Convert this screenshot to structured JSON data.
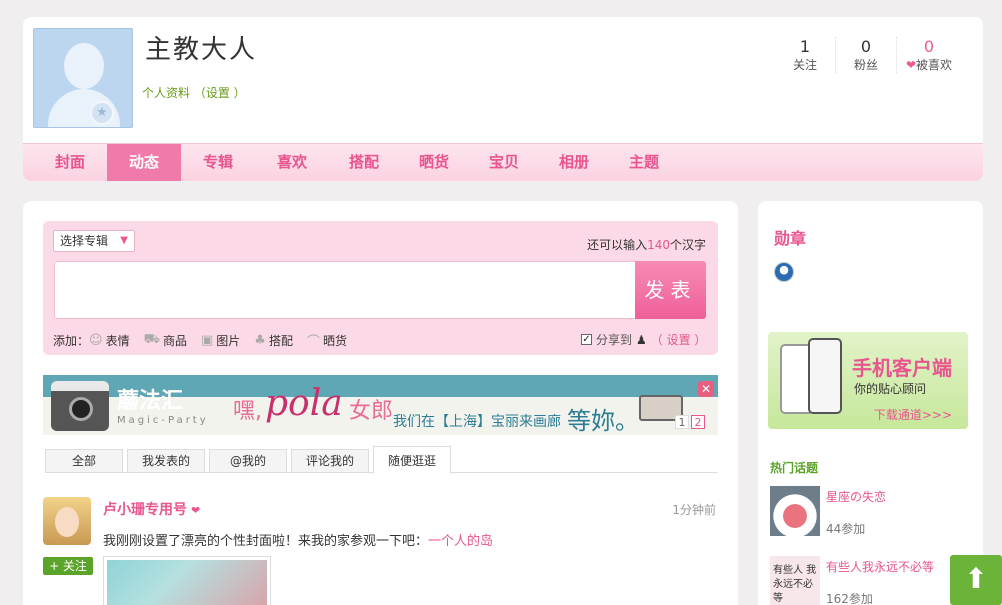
{
  "profile": {
    "name": "主教大人",
    "links_text": "个人资料 （设置 ）",
    "stats": [
      {
        "num": "1",
        "label": "关注"
      },
      {
        "num": "0",
        "label": "粉丝"
      },
      {
        "num": "0",
        "label": "被喜欢"
      }
    ]
  },
  "nav": [
    "封面",
    "动态",
    "专辑",
    "喜欢",
    "搭配",
    "晒货",
    "宝贝",
    "相册",
    "主题"
  ],
  "post_box": {
    "album_select": "选择专辑",
    "char_count_prefix": "还可以输入",
    "char_count": "140",
    "char_count_suffix": "个汉字",
    "publish": "发表",
    "add_label": "添加：",
    "tools": [
      "表情",
      "商品",
      "图片",
      "搭配",
      "晒货"
    ],
    "share_label": "分享到",
    "setting": "（ 设置 ）"
  },
  "banner": {
    "brand": "蘑法汇",
    "brand_sub": "Magic-Party",
    "hey": "嘿,",
    "pola": "pola",
    "nvlang": "女郎",
    "slogan": "我们在【上海】宝丽来画廊",
    "wait": "等妳。",
    "pages": [
      "1",
      "2"
    ]
  },
  "tabs": [
    "全部",
    "我发表的",
    "@我的",
    "评论我的",
    "随便逛逛"
  ],
  "feed_post": {
    "author": "卢小珊专用号",
    "time": "1分钟前",
    "text": "我刚刚设置了漂亮的个性封面啦！来我的家参观一下吧：",
    "link": "一个人的岛",
    "follow": "+ 关注"
  },
  "sidebar": {
    "medals_title": "勋章",
    "app_title": "手机客户端",
    "app_sub": "你的贴心顾问",
    "app_link": "下载通道>>>",
    "hot_title": "热门话题",
    "topics": [
      {
        "name": "星座の失恋",
        "count": "44参加"
      },
      {
        "name": "有些人我永远不必等",
        "count": "162参加",
        "thumb_text": "有些人 我永远不必等"
      }
    ]
  },
  "colors": {
    "accent": "#e8558f",
    "green": "#5ba42a",
    "nav_active": "#f07aa9"
  }
}
